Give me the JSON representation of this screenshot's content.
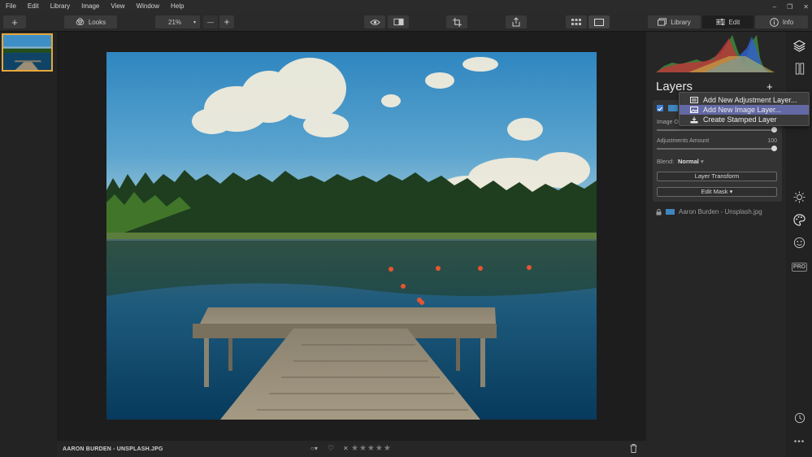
{
  "menu": {
    "items": [
      "File",
      "Edit",
      "Library",
      "Image",
      "View",
      "Window",
      "Help"
    ],
    "window_controls": [
      "–",
      "❐",
      "✕"
    ]
  },
  "toolbar": {
    "add_label": "+",
    "looks_label": "Looks",
    "zoom_value": "21%",
    "zoom_minus": "—",
    "zoom_plus": "+",
    "library_tab": "Library",
    "edit_tab": "Edit",
    "info_tab": "Info"
  },
  "statusbar": {
    "filename": "AARON BURDEN - UNSPLASH.JPG",
    "rating_stars": "★★★★★",
    "reject_label": "✕"
  },
  "layers_panel": {
    "title": "Layers",
    "add_label": "+",
    "image_opacity_label": "Image O",
    "adjustments_amount_label": "Adjustments Amount",
    "adjustments_amount_value": "100",
    "blend_label": "Blend:",
    "blend_value": "Normal",
    "layer_transform_label": "Layer Transform",
    "edit_mask_label": "Edit Mask",
    "base_layer_name": "Aaron Burden - Unsplash.jpg"
  },
  "context_menu": {
    "items": [
      {
        "label": "Add New Adjustment Layer...",
        "highlighted": false
      },
      {
        "label": "Add New Image Layer...",
        "highlighted": true
      },
      {
        "label": "Create Stamped Layer",
        "highlighted": false
      }
    ]
  },
  "sidebar": {
    "pro_label": "PRO"
  },
  "colors": {
    "selection_accent": "#e7a83a",
    "menu_highlight": "#6369a4"
  }
}
